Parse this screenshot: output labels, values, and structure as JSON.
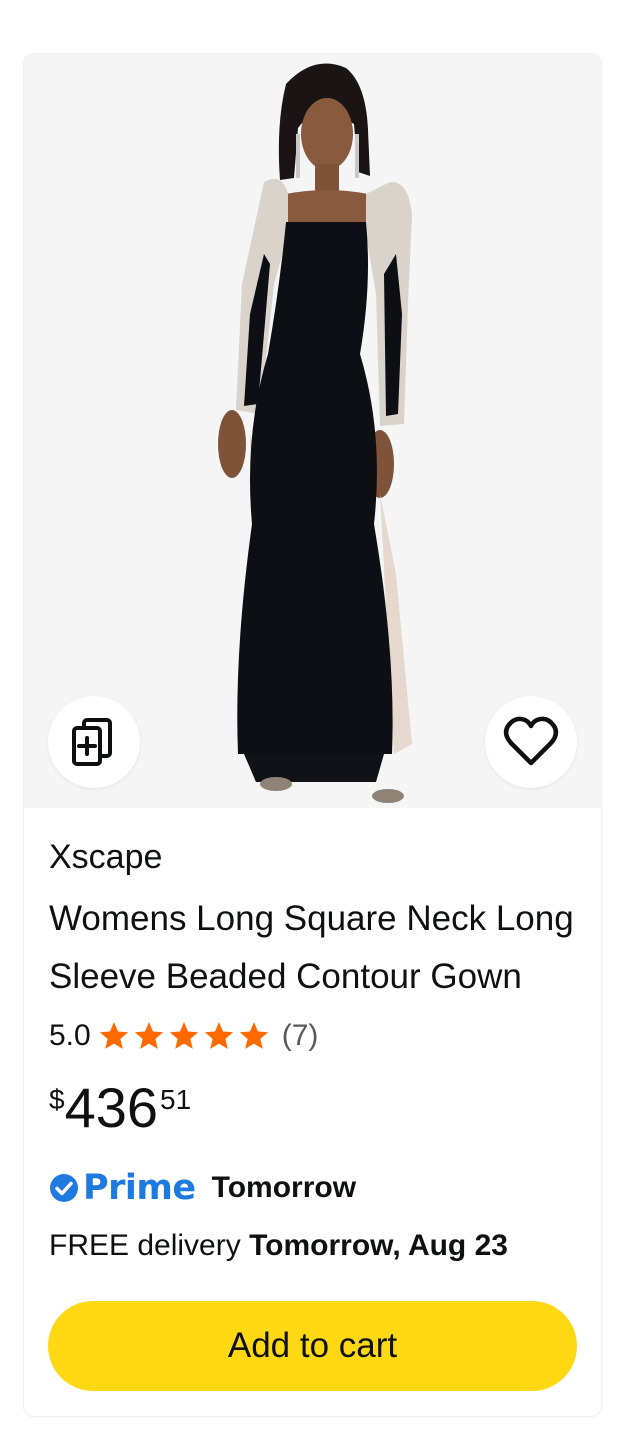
{
  "product": {
    "brand": "Xscape",
    "title": "Womens Long Square Neck Long Sleeve Beaded Contour Gown",
    "rating": "5.0",
    "review_count": "(7)",
    "stars_filled": 5,
    "price": {
      "symbol": "$",
      "whole": "436",
      "fraction": "51"
    },
    "prime": {
      "label": "Prime",
      "delivery_day": "Tomorrow"
    },
    "delivery": {
      "prefix": "FREE delivery",
      "date": "Tomorrow, Aug 23"
    },
    "add_to_cart_label": "Add to cart"
  },
  "icons": {
    "compare": "compare-icon",
    "wishlist": "heart-icon",
    "star": "star-icon",
    "prime_check": "check-circle-icon"
  },
  "colors": {
    "star": "#ff6a00",
    "prime": "#1f7ae0",
    "cart_button": "#ffd814",
    "image_bg": "#f5f5f5"
  }
}
